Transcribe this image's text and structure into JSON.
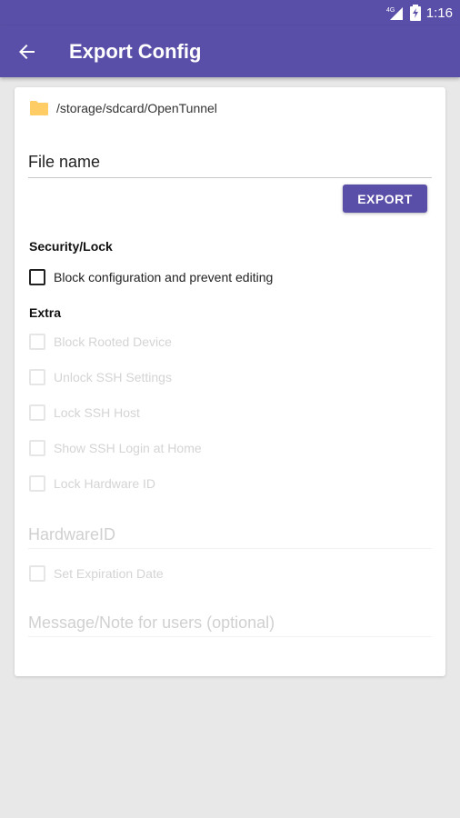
{
  "status_bar": {
    "network_label": "4G",
    "time": "1:16"
  },
  "app_bar": {
    "title": "Export Config"
  },
  "path": "/storage/sdcard/OpenTunnel",
  "file_name": {
    "placeholder": "File name",
    "value": ""
  },
  "export_label": "EXPORT",
  "security": {
    "title": "Security/Lock",
    "block_label": "Block configuration and prevent editing"
  },
  "extra": {
    "title": "Extra",
    "options": [
      "Block Rooted Device",
      "Unlock SSH Settings",
      "Lock SSH Host",
      "Show SSH Login at Home",
      "Lock Hardware ID"
    ]
  },
  "hardware_id": {
    "placeholder": "HardwareID"
  },
  "expiration_label": "Set Expiration Date",
  "message": {
    "placeholder": "Message/Note for users (optional)"
  },
  "colors": {
    "primary": "#5a4fa8",
    "folder": "#ffcc66",
    "disabled_text": "#d4d4d4"
  }
}
